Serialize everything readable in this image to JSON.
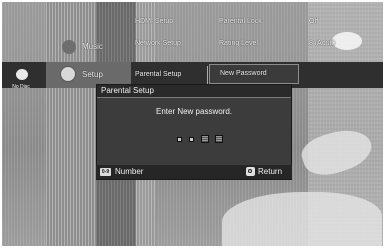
{
  "top_menu": {
    "hdmi_setup": "HDMI Setup",
    "parental_lock": "Parental Lock",
    "off_value": "Off",
    "network_setup": "Network Setup",
    "rating_level": "Rating Level",
    "adult_value": "8 (Adult)"
  },
  "sidebar": {
    "disc_label": "No Disc",
    "music": "Music",
    "setup": "Setup"
  },
  "menu_row": {
    "parental_setup": "Parental Setup",
    "new_password": "New Password"
  },
  "dialog": {
    "title": "Parental Setup",
    "prompt": "Enter New password.",
    "entered_digits": 2,
    "total_digits": 4
  },
  "footer": {
    "number_key": "0-9",
    "number_label": "Number",
    "return_label": "Return"
  }
}
